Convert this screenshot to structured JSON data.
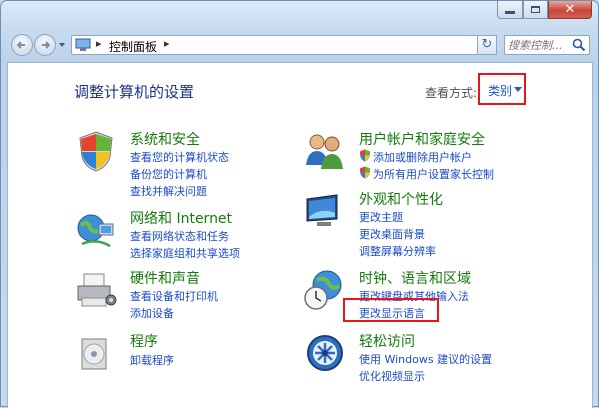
{
  "window": {
    "address_path": "控制面板",
    "search_placeholder": "搜索控制..."
  },
  "page": {
    "title": "调整计算机的设置",
    "view_label": "查看方式:",
    "view_value": "类别"
  },
  "categories": [
    {
      "title": "系统和安全",
      "links": [
        "查看您的计算机状态",
        "备份您的计算机",
        "查找并解决问题"
      ]
    },
    {
      "title": "网络和 Internet",
      "links": [
        "查看网络状态和任务",
        "选择家庭组和共享选项"
      ]
    },
    {
      "title": "硬件和声音",
      "links": [
        "查看设备和打印机",
        "添加设备"
      ]
    },
    {
      "title": "程序",
      "links": [
        "卸载程序"
      ]
    },
    {
      "title": "用户帐户和家庭安全",
      "links": [
        "添加或删除用户帐户",
        "为所有用户设置家长控制"
      ]
    },
    {
      "title": "外观和个性化",
      "links": [
        "更改主题",
        "更改桌面背景",
        "调整屏幕分辨率"
      ]
    },
    {
      "title": "时钟、语言和区域",
      "links": [
        "更改键盘或其他输入法",
        "更改显示语言"
      ]
    },
    {
      "title": "轻松访问",
      "links": [
        "使用 Windows 建议的设置",
        "优化视频显示"
      ]
    }
  ],
  "colors": {
    "accent_link": "#1b4bc8",
    "category_title": "#157a0b",
    "highlight": "#e8151b",
    "page_title": "#1e3287"
  }
}
